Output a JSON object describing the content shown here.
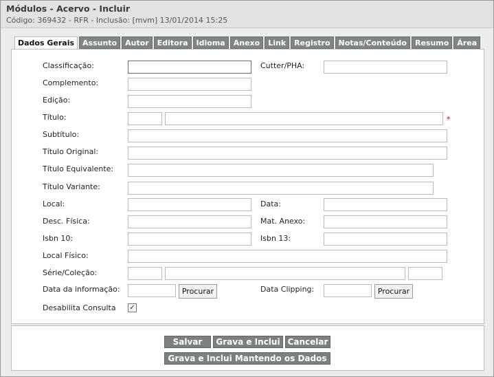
{
  "header": {
    "title": "Módulos - Acervo - Incluir",
    "subtitle": "Código: 369432 - RFR - Inclusão: [mvm] 13/01/2014 15:25"
  },
  "tabs": [
    {
      "label": "Dados Gerais",
      "active": true
    },
    {
      "label": "Assunto"
    },
    {
      "label": "Autor"
    },
    {
      "label": "Editora"
    },
    {
      "label": "Idioma"
    },
    {
      "label": "Anexo"
    },
    {
      "label": "Link"
    },
    {
      "label": "Registro"
    },
    {
      "label": "Notas/Conteúdo"
    },
    {
      "label": "Resumo"
    },
    {
      "label": "Área"
    }
  ],
  "form": {
    "classificacao": {
      "label": "Classificação:",
      "value": ""
    },
    "cutter": {
      "label": "Cutter/PHA:",
      "value": ""
    },
    "complemento": {
      "label": "Complemento:",
      "value": ""
    },
    "edicao": {
      "label": "Edição:",
      "value": ""
    },
    "titulo": {
      "label": "Título:",
      "prefix": "",
      "value": "",
      "required_mark": "*"
    },
    "subtitulo": {
      "label": "Subtítulo:",
      "value": ""
    },
    "titulo_original": {
      "label": "Título Original:",
      "value": ""
    },
    "titulo_equivalente": {
      "label": "Título Equivalente:",
      "value": ""
    },
    "titulo_variante": {
      "label": "Título Variante:",
      "value": ""
    },
    "local": {
      "label": "Local:",
      "value": ""
    },
    "data": {
      "label": "Data:",
      "value": ""
    },
    "desc_fisica": {
      "label": "Desc. Física:",
      "value": ""
    },
    "mat_anexo": {
      "label": "Mat. Anexo:",
      "value": ""
    },
    "isbn10": {
      "label": "Isbn 10:",
      "value": ""
    },
    "isbn13": {
      "label": "Isbn 13:",
      "value": ""
    },
    "local_fisico": {
      "label": "Local Físico:",
      "value": ""
    },
    "serie_colecao": {
      "label": "Série/Coleção:",
      "a": "",
      "b": "",
      "c": ""
    },
    "data_informacao": {
      "label": "Data da informação:",
      "value": "",
      "button": "Procurar"
    },
    "data_clipping": {
      "label": "Data Clipping:",
      "value": "",
      "button": "Procurar"
    },
    "desabilita_consulta": {
      "label": "Desabilita Consulta",
      "checked": true,
      "check_glyph": "✓"
    }
  },
  "actions": {
    "salvar": "Salvar",
    "grava_inclui": "Grava e Inclui",
    "cancelar": "Cancelar",
    "grava_inclui_mantendo": "Grava e Inclui Mantendo os Dados"
  }
}
